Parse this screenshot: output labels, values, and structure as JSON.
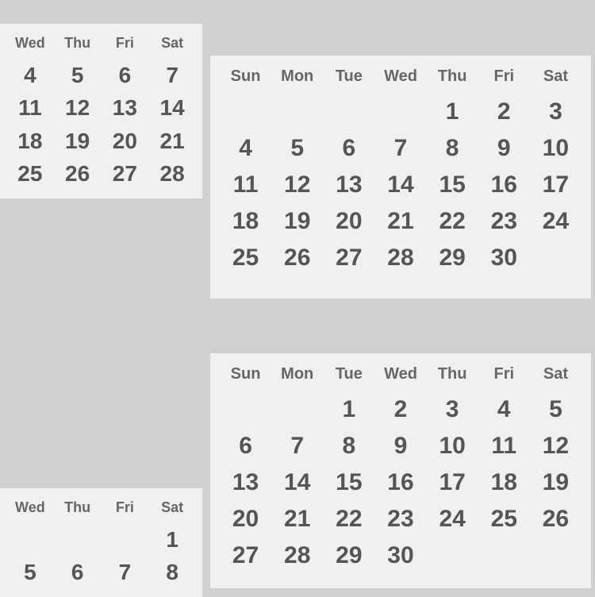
{
  "calendars": {
    "topLeft": {
      "headers": [
        "Wed",
        "Thu",
        "Fri",
        "Sat"
      ],
      "rows": [
        [
          "4",
          "5",
          "6",
          "7"
        ],
        [
          "11",
          "12",
          "13",
          "14"
        ],
        [
          "18",
          "19",
          "20",
          "21"
        ],
        [
          "25",
          "26",
          "27",
          "28"
        ]
      ]
    },
    "topRight": {
      "headers": [
        "Sun",
        "Mon",
        "Tue",
        "Wed",
        "Thu",
        "Fri",
        "Sat"
      ],
      "rows": [
        [
          "",
          "",
          "",
          "",
          "1",
          "2",
          "3",
          "4"
        ],
        [
          "5",
          "6",
          "7",
          "8",
          "9",
          "10",
          "11"
        ],
        [
          "12",
          "13",
          "14",
          "15",
          "16",
          "17",
          "18"
        ],
        [
          "19",
          "20",
          "21",
          "22",
          "23",
          "24",
          "25"
        ],
        [
          "26",
          "27",
          "28",
          "29",
          "30",
          "",
          ""
        ]
      ]
    },
    "bottomRight": {
      "headers": [
        "Sun",
        "Mon",
        "Tue",
        "Wed",
        "Thu",
        "Fri",
        "Sat"
      ],
      "rows": [
        [
          "",
          "",
          "1",
          "2",
          "3",
          "4",
          "5"
        ],
        [
          "6",
          "7",
          "8",
          "9",
          "10",
          "11",
          "12"
        ],
        [
          "13",
          "14",
          "15",
          "16",
          "17",
          "18",
          "19"
        ],
        [
          "20",
          "21",
          "22",
          "23",
          "24",
          "25",
          "26"
        ],
        [
          "27",
          "28",
          "29",
          "30",
          "",
          "",
          ""
        ]
      ]
    },
    "bottomLeft": {
      "headers": [
        "Wed",
        "Thu",
        "Fri",
        "Sat"
      ],
      "rows": [
        [
          "",
          "",
          "",
          "1"
        ],
        [
          "5",
          "6",
          "7",
          "8"
        ]
      ]
    }
  }
}
